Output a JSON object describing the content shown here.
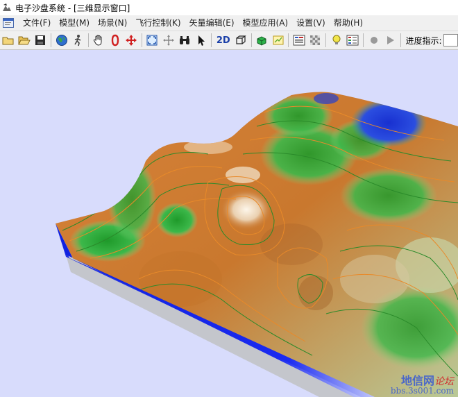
{
  "window": {
    "title": "电子沙盘系统 - [三维显示窗口]"
  },
  "menu": [
    {
      "label": "文件(F)"
    },
    {
      "label": "模型(M)"
    },
    {
      "label": "场景(N)"
    },
    {
      "label": "飞行控制(K)"
    },
    {
      "label": "矢量编辑(E)"
    },
    {
      "label": "模型应用(A)"
    },
    {
      "label": "设置(V)"
    },
    {
      "label": "帮助(H)"
    }
  ],
  "toolbar": {
    "items": [
      {
        "icon": "new-file-icon"
      },
      {
        "icon": "open-folder-icon"
      },
      {
        "icon": "save-icon"
      },
      {
        "icon": "globe-icon"
      },
      {
        "icon": "walk-icon"
      },
      {
        "icon": "pan-hand-icon"
      },
      {
        "icon": "rotate-icon"
      },
      {
        "icon": "move-arrows-icon"
      },
      {
        "icon": "full-extent-icon"
      },
      {
        "icon": "cross-arrows-icon"
      },
      {
        "icon": "binoculars-icon"
      },
      {
        "icon": "pointer-icon"
      },
      {
        "icon": "view-2d"
      },
      {
        "icon": "cube-icon"
      },
      {
        "icon": "green-box-icon"
      },
      {
        "icon": "layer-icon"
      },
      {
        "icon": "list-settings-icon"
      },
      {
        "icon": "checker-icon"
      },
      {
        "icon": "bulb-icon"
      },
      {
        "icon": "legend-icon"
      },
      {
        "icon": "stop-icon"
      },
      {
        "icon": "play-icon"
      }
    ],
    "view2d_label": "2D",
    "progress_label": "进度指示:"
  },
  "viewport": {
    "background_color": "#d8dcfc",
    "scene": "3d-terrain-model"
  },
  "watermark": {
    "line1": "地信网",
    "line1_red": "论坛",
    "line2": "bbs.3s001.com"
  }
}
